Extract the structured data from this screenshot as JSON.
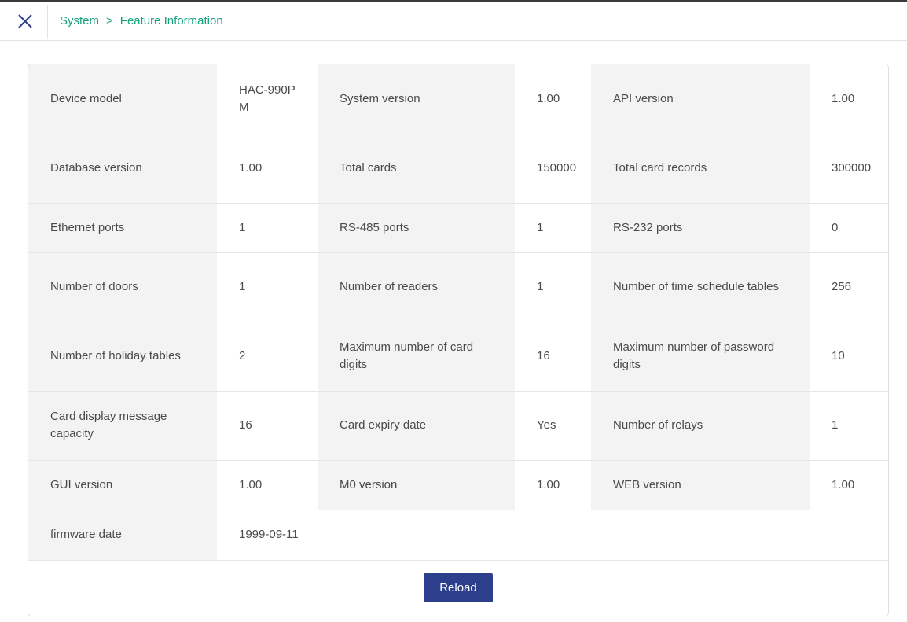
{
  "header": {
    "breadcrumb_root": "System",
    "breadcrumb_separator": ">",
    "breadcrumb_current": "Feature Information"
  },
  "rows": [
    [
      {
        "label": "Device model",
        "value": "HAC-990PM"
      },
      {
        "label": "System version",
        "value": "1.00"
      },
      {
        "label": "API version",
        "value": "1.00"
      }
    ],
    [
      {
        "label": "Database version",
        "value": "1.00"
      },
      {
        "label": "Total cards",
        "value": "150000"
      },
      {
        "label": "Total card records",
        "value": "300000"
      }
    ],
    [
      {
        "label": "Ethernet ports",
        "value": "1"
      },
      {
        "label": "RS-485 ports",
        "value": "1"
      },
      {
        "label": "RS-232 ports",
        "value": "0"
      }
    ],
    [
      {
        "label": "Number of doors",
        "value": "1"
      },
      {
        "label": "Number of readers",
        "value": "1"
      },
      {
        "label": "Number of time schedule tables",
        "value": "256"
      }
    ],
    [
      {
        "label": "Number of holiday tables",
        "value": "2"
      },
      {
        "label": "Maximum number of card digits",
        "value": "16"
      },
      {
        "label": "Maximum number of password digits",
        "value": "10"
      }
    ],
    [
      {
        "label": "Card display message capacity",
        "value": "16"
      },
      {
        "label": "Card expiry date",
        "value": "Yes"
      },
      {
        "label": "Number of relays",
        "value": "1"
      }
    ],
    [
      {
        "label": "GUI version",
        "value": "1.00"
      },
      {
        "label": "M0 version",
        "value": "1.00"
      },
      {
        "label": "WEB version",
        "value": "1.00"
      }
    ]
  ],
  "firmware": {
    "label": "firmware date",
    "value": "1999-09-11"
  },
  "footer": {
    "reload_label": "Reload"
  },
  "colors": {
    "accent": "#17a27c",
    "button": "#2d3f8c",
    "label_bg": "#f3f3f3"
  }
}
